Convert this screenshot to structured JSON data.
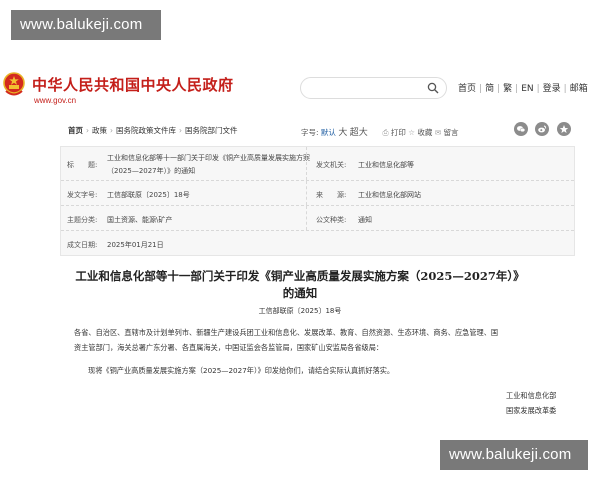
{
  "watermark": {
    "top": "www.balukeji.com",
    "bottom": "www.balukeji.com"
  },
  "header": {
    "site_title": "中华人民共和国中央人民政府",
    "site_url": "www.gov.cn",
    "search_placeholder": "",
    "nav": [
      "首页",
      "简",
      "繁",
      "EN",
      "登录",
      "邮箱"
    ]
  },
  "breadcrumb": [
    "首页",
    "政策",
    "国务院政策文件库",
    "国务院部门文件"
  ],
  "tools": {
    "font_size_label": "字号:",
    "font_default": "默认",
    "font_large": "大",
    "font_xlarge": "超大",
    "print": "打印",
    "favorite": "收藏",
    "comment": "留言"
  },
  "share_icons": [
    "wechat-icon",
    "weibo-icon",
    "qzone-icon"
  ],
  "meta": {
    "title_label": "标　　题:",
    "title_line1": "工业和信息化部等十一部门关于印发《铜产业高质量发展实施方案",
    "title_line2": "（2025—2027年）》的通知",
    "issuer_label": "发文机关:",
    "issuer": "工业和信息化部等",
    "doc_no_label": "发文字号:",
    "doc_no": "工信部联原〔2025〕18号",
    "source_label": "来　　源:",
    "source": "工业和信息化部网站",
    "topic_label": "主题分类:",
    "topic": "国土资源、能源\\矿产",
    "type_label": "公文种类:",
    "type": "通知",
    "date_label": "成文日期:",
    "date": "2025年01月21日"
  },
  "doc": {
    "title_line1": "工业和信息化部等十一部门关于印发《铜产业高质量发展实施方案（2025—2027年）》",
    "title_line2": "的通知",
    "number": "工信部联原〔2025〕18号",
    "para1_line1": "各省、自治区、直辖市及计划单列市、新疆生产建设兵团工业和信息化、发展改革、教育、自然资源、生态环境、商务、应急管理、国",
    "para1_line2": "资主管部门，海关总署广东分署、各直属海关，中国证监会各监管局，国家矿山安监局各省级局：",
    "para2": "现将《铜产业高质量发展实施方案（2025—2027年）》印发给你们，请结合实际认真抓好落实。",
    "sign1": "工业和信息化部",
    "sign2": "国家发展改革委"
  }
}
